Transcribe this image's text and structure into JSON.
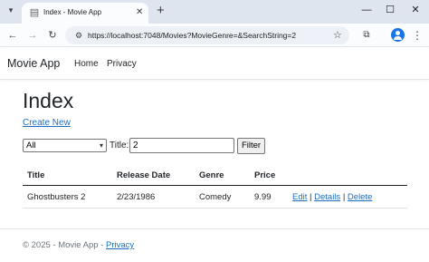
{
  "browser": {
    "tab": {
      "title": "Index - Movie App",
      "favicon": "page-icon",
      "close_glyph": "✕"
    },
    "new_tab_glyph": "+",
    "window_controls": {
      "minimize": "—",
      "maximize": "☐",
      "close": "✕"
    },
    "toolbar": {
      "back": "←",
      "forward": "→",
      "reload": "↻",
      "url": "https://localhost:7048/Movies?MovieGenre=&SearchString=2",
      "bookmark": "☆",
      "menu": "⋮"
    }
  },
  "site": {
    "brand": "Movie App",
    "nav": [
      "Home",
      "Privacy"
    ]
  },
  "page": {
    "title": "Index",
    "create_link": "Create New",
    "filter": {
      "genre_selected": "All",
      "title_label": "Title:",
      "title_value": "2",
      "button": "Filter"
    },
    "table": {
      "headers": [
        "Title",
        "Release Date",
        "Genre",
        "Price"
      ],
      "rows": [
        {
          "title": "Ghostbusters 2",
          "release_date": "2/23/1986",
          "genre": "Comedy",
          "price": "9.99",
          "edit": "Edit",
          "details": "Details",
          "delete": "Delete",
          "separator": "|"
        }
      ]
    }
  },
  "footer": {
    "text": "© 2025 - Movie App - ",
    "privacy_link": "Privacy"
  },
  "colors": {
    "link": "#1b6ec2",
    "tabstrip": "#dfe5ef",
    "profile": "#1a73e8"
  }
}
